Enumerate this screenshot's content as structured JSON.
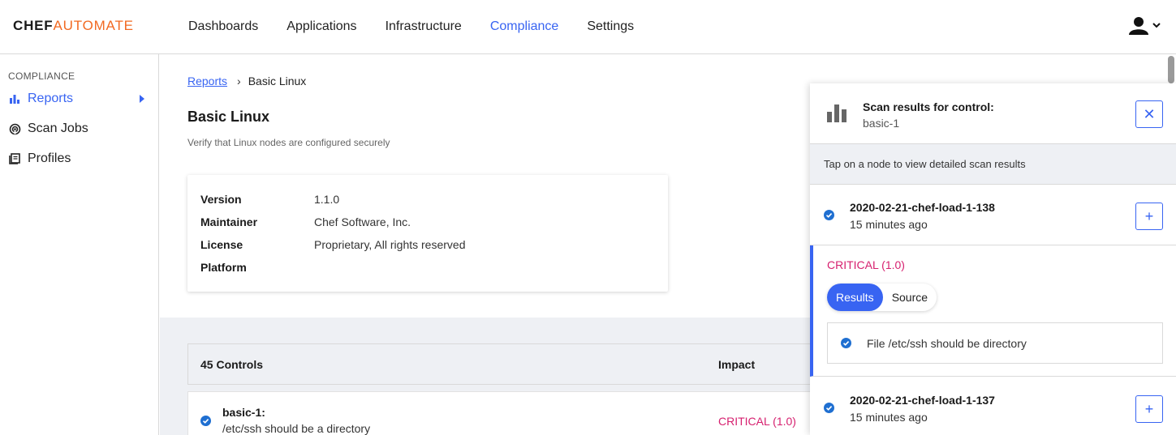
{
  "brand": {
    "part1": "CHEF",
    "part2": "AUTOMATE"
  },
  "nav": [
    {
      "label": "Dashboards",
      "active": false
    },
    {
      "label": "Applications",
      "active": false
    },
    {
      "label": "Infrastructure",
      "active": false
    },
    {
      "label": "Compliance",
      "active": true
    },
    {
      "label": "Settings",
      "active": false
    }
  ],
  "sidebar": {
    "heading": "COMPLIANCE",
    "items": [
      {
        "label": "Reports",
        "icon": "bar-chart-icon",
        "active": true
      },
      {
        "label": "Scan Jobs",
        "icon": "radar-icon",
        "active": false
      },
      {
        "label": "Profiles",
        "icon": "book-icon",
        "active": false
      }
    ]
  },
  "breadcrumb": {
    "link": "Reports",
    "current": "Basic Linux"
  },
  "profile": {
    "title": "Basic Linux",
    "description": "Verify that Linux nodes are configured securely",
    "meta": [
      {
        "key": "Version",
        "value": "1.1.0"
      },
      {
        "key": "Maintainer",
        "value": "Chef Software, Inc."
      },
      {
        "key": "License",
        "value": "Proprietary, All rights reserved"
      },
      {
        "key": "Platform",
        "value": ""
      }
    ]
  },
  "controls": {
    "count_label": "45 Controls",
    "impact_header": "Impact",
    "rows": [
      {
        "id": "basic-1:",
        "desc": "/etc/ssh should be a directory",
        "impact": "CRITICAL (1.0)"
      }
    ]
  },
  "panel": {
    "title": "Scan results for control:",
    "subtitle": "basic-1",
    "close_icon": "close-icon",
    "tap_hint": "Tap on a node to view detailed scan results",
    "nodes": [
      {
        "name": "2020-02-21-chef-load-1-138",
        "time": "15 minutes ago"
      },
      {
        "name": "2020-02-21-chef-load-1-137",
        "time": "15 minutes ago"
      }
    ],
    "expanded": {
      "impact": "CRITICAL (1.0)",
      "tabs": [
        "Results",
        "Source"
      ],
      "result": "File /etc/ssh should be directory"
    }
  },
  "colors": {
    "accent": "#3864f2",
    "critical": "#d6206f",
    "brand_orange": "#f26a22"
  }
}
